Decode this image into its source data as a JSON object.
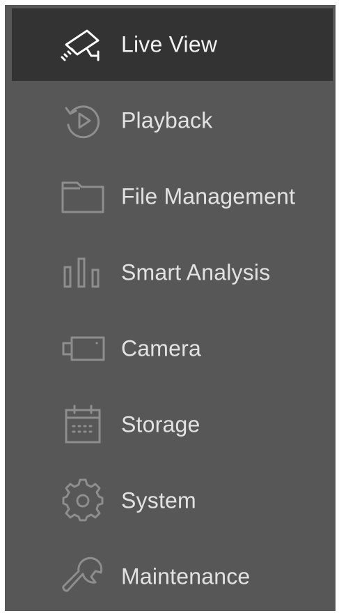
{
  "nav": {
    "items": [
      {
        "label": "Live View",
        "icon": "cctv-camera-icon",
        "active": true
      },
      {
        "label": "Playback",
        "icon": "playback-icon",
        "active": false
      },
      {
        "label": "File Management",
        "icon": "folder-icon",
        "active": false
      },
      {
        "label": "Smart Analysis",
        "icon": "bar-chart-icon",
        "active": false
      },
      {
        "label": "Camera",
        "icon": "camera-icon",
        "active": false
      },
      {
        "label": "Storage",
        "icon": "calendar-storage-icon",
        "active": false
      },
      {
        "label": "System",
        "icon": "gear-icon",
        "active": false
      },
      {
        "label": "Maintenance",
        "icon": "wrench-icon",
        "active": false
      }
    ]
  },
  "colors": {
    "sidebar_bg": "#575757",
    "active_bg": "#333333",
    "text": "#e2e2e2",
    "icon": "#8e8e8e",
    "active_icon": "#ffffff"
  }
}
